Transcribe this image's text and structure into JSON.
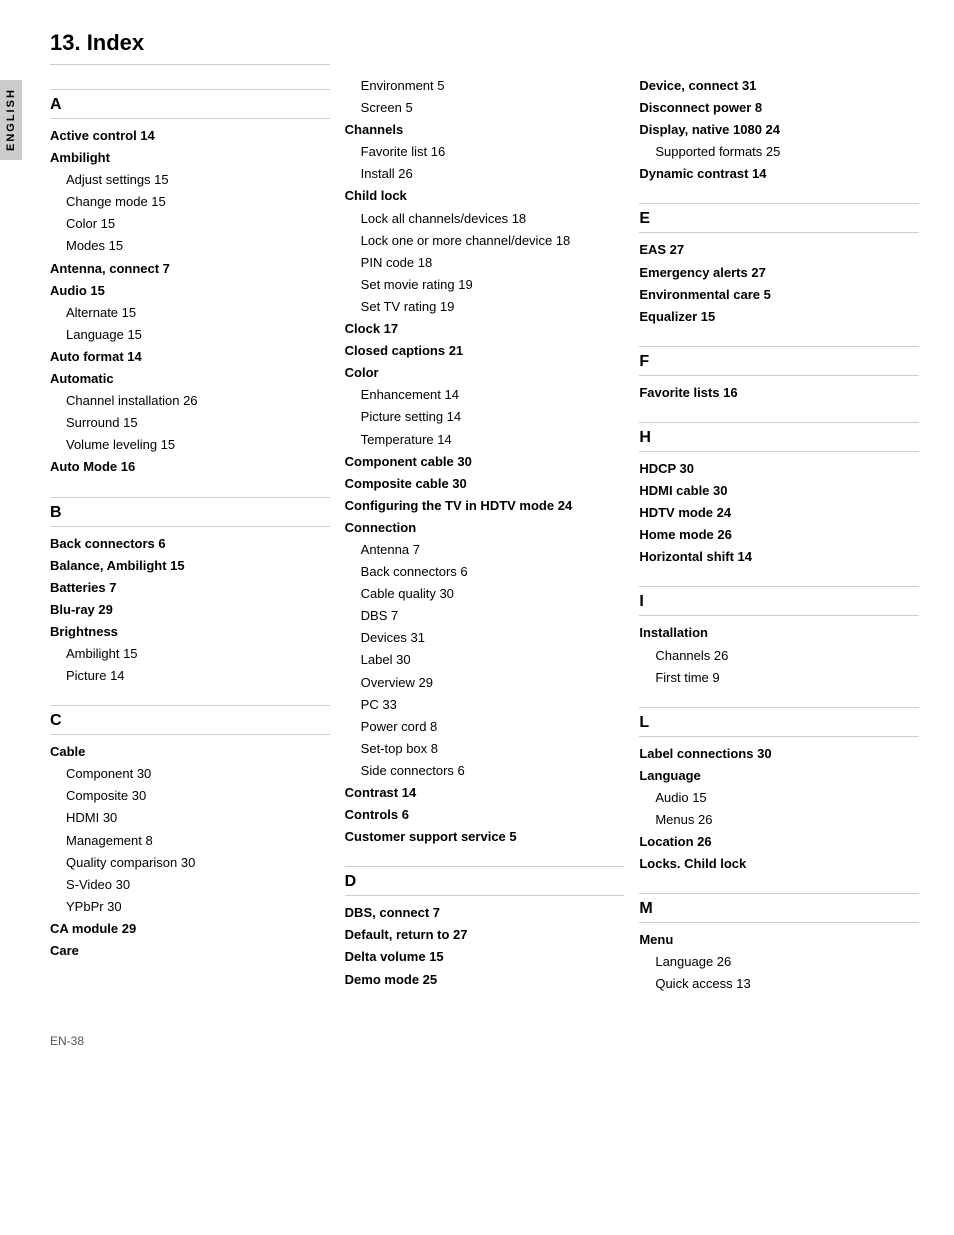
{
  "page": {
    "tab_label": "ENGLISH",
    "title": "13.  Index",
    "footer": "EN-38"
  },
  "col1": {
    "sections": [
      {
        "letter": "A",
        "entries": [
          {
            "text": "Active control  14",
            "bold": true,
            "indent": false
          },
          {
            "text": "Ambilight",
            "bold": true,
            "indent": false
          },
          {
            "text": "Adjust settings  15",
            "bold": false,
            "indent": true
          },
          {
            "text": "Change mode  15",
            "bold": false,
            "indent": true
          },
          {
            "text": "Color  15",
            "bold": false,
            "indent": true
          },
          {
            "text": "Modes  15",
            "bold": false,
            "indent": true
          },
          {
            "text": "Antenna, connect  7",
            "bold": true,
            "indent": false
          },
          {
            "text": "Audio  15",
            "bold": true,
            "indent": false
          },
          {
            "text": "Alternate  15",
            "bold": false,
            "indent": true
          },
          {
            "text": "Language  15",
            "bold": false,
            "indent": true
          },
          {
            "text": "Auto format  14",
            "bold": true,
            "indent": false
          },
          {
            "text": "Automatic",
            "bold": true,
            "indent": false
          },
          {
            "text": "Channel installation  26",
            "bold": false,
            "indent": true
          },
          {
            "text": "Surround  15",
            "bold": false,
            "indent": true
          },
          {
            "text": "Volume leveling  15",
            "bold": false,
            "indent": true
          },
          {
            "text": "Auto Mode  16",
            "bold": true,
            "indent": false
          }
        ]
      },
      {
        "letter": "B",
        "entries": [
          {
            "text": "Back connectors  6",
            "bold": true,
            "indent": false
          },
          {
            "text": "Balance, Ambilight  15",
            "bold": true,
            "indent": false
          },
          {
            "text": "Batteries  7",
            "bold": true,
            "indent": false
          },
          {
            "text": "Blu-ray  29",
            "bold": true,
            "indent": false
          },
          {
            "text": "Brightness",
            "bold": true,
            "indent": false
          },
          {
            "text": "Ambilight  15",
            "bold": false,
            "indent": true
          },
          {
            "text": "Picture  14",
            "bold": false,
            "indent": true
          }
        ]
      },
      {
        "letter": "C",
        "entries": [
          {
            "text": "Cable",
            "bold": true,
            "indent": false
          },
          {
            "text": "Component  30",
            "bold": false,
            "indent": true
          },
          {
            "text": "Composite  30",
            "bold": false,
            "indent": true
          },
          {
            "text": "HDMI  30",
            "bold": false,
            "indent": true
          },
          {
            "text": "Management  8",
            "bold": false,
            "indent": true
          },
          {
            "text": "Quality comparison  30",
            "bold": false,
            "indent": true
          },
          {
            "text": "S-Video  30",
            "bold": false,
            "indent": true
          },
          {
            "text": "YPbPr  30",
            "bold": false,
            "indent": true
          },
          {
            "text": "CA module  29",
            "bold": true,
            "indent": false
          },
          {
            "text": "Care",
            "bold": true,
            "indent": false
          }
        ]
      }
    ]
  },
  "col2": {
    "sections": [
      {
        "letter": "",
        "entries": [
          {
            "text": "Environment  5",
            "bold": false,
            "indent": true
          },
          {
            "text": "Screen  5",
            "bold": false,
            "indent": true
          },
          {
            "text": "Channels",
            "bold": true,
            "indent": false
          },
          {
            "text": "Favorite list  16",
            "bold": false,
            "indent": true
          },
          {
            "text": "Install  26",
            "bold": false,
            "indent": true
          },
          {
            "text": "Child lock",
            "bold": true,
            "indent": false
          },
          {
            "text": "Lock all channels/devices  18",
            "bold": false,
            "indent": true
          },
          {
            "text": "Lock one or more channel/device  18",
            "bold": false,
            "indent": true
          },
          {
            "text": "PIN code  18",
            "bold": false,
            "indent": true
          },
          {
            "text": "Set movie rating  19",
            "bold": false,
            "indent": true
          },
          {
            "text": "Set TV rating  19",
            "bold": false,
            "indent": true
          },
          {
            "text": "Clock  17",
            "bold": true,
            "indent": false
          },
          {
            "text": "Closed captions  21",
            "bold": true,
            "indent": false
          },
          {
            "text": "Color",
            "bold": true,
            "indent": false
          },
          {
            "text": "Enhancement  14",
            "bold": false,
            "indent": true
          },
          {
            "text": "Picture setting  14",
            "bold": false,
            "indent": true
          },
          {
            "text": "Temperature  14",
            "bold": false,
            "indent": true
          },
          {
            "text": "Component cable  30",
            "bold": true,
            "indent": false
          },
          {
            "text": "Composite cable  30",
            "bold": true,
            "indent": false
          },
          {
            "text": "Configuring the TV in HDTV mode  24",
            "bold": true,
            "indent": false
          },
          {
            "text": "Connection",
            "bold": true,
            "indent": false
          },
          {
            "text": "Antenna  7",
            "bold": false,
            "indent": true
          },
          {
            "text": "Back connectors  6",
            "bold": false,
            "indent": true
          },
          {
            "text": "Cable quality  30",
            "bold": false,
            "indent": true
          },
          {
            "text": "DBS  7",
            "bold": false,
            "indent": true
          },
          {
            "text": "Devices  31",
            "bold": false,
            "indent": true
          },
          {
            "text": "Label  30",
            "bold": false,
            "indent": true
          },
          {
            "text": "Overview  29",
            "bold": false,
            "indent": true
          },
          {
            "text": "PC  33",
            "bold": false,
            "indent": true
          },
          {
            "text": "Power cord  8",
            "bold": false,
            "indent": true
          },
          {
            "text": "Set-top box  8",
            "bold": false,
            "indent": true
          },
          {
            "text": "Side connectors  6",
            "bold": false,
            "indent": true
          },
          {
            "text": "Contrast  14",
            "bold": true,
            "indent": false
          },
          {
            "text": "Controls  6",
            "bold": true,
            "indent": false
          },
          {
            "text": "Customer support service  5",
            "bold": true,
            "indent": false
          }
        ]
      },
      {
        "letter": "D",
        "entries": [
          {
            "text": "DBS, connect  7",
            "bold": true,
            "indent": false
          },
          {
            "text": "Default, return to  27",
            "bold": true,
            "indent": false
          },
          {
            "text": "Delta volume  15",
            "bold": true,
            "indent": false
          },
          {
            "text": "Demo mode  25",
            "bold": true,
            "indent": false
          }
        ]
      }
    ]
  },
  "col3": {
    "sections": [
      {
        "letter": "",
        "entries": [
          {
            "text": "Device, connect  31",
            "bold": true,
            "indent": false
          },
          {
            "text": "Disconnect power  8",
            "bold": true,
            "indent": false
          },
          {
            "text": "Display, native 1080  24",
            "bold": true,
            "indent": false
          },
          {
            "text": "Supported formats  25",
            "bold": false,
            "indent": true
          },
          {
            "text": "Dynamic contrast  14",
            "bold": true,
            "indent": false
          }
        ]
      },
      {
        "letter": "E",
        "entries": [
          {
            "text": "EAS  27",
            "bold": true,
            "indent": false
          },
          {
            "text": "Emergency alerts  27",
            "bold": true,
            "indent": false
          },
          {
            "text": "Environmental care  5",
            "bold": true,
            "indent": false
          },
          {
            "text": "Equalizer  15",
            "bold": true,
            "indent": false
          }
        ]
      },
      {
        "letter": "F",
        "entries": [
          {
            "text": "Favorite lists  16",
            "bold": true,
            "indent": false
          }
        ]
      },
      {
        "letter": "H",
        "entries": [
          {
            "text": "HDCP  30",
            "bold": true,
            "indent": false
          },
          {
            "text": "HDMI cable  30",
            "bold": true,
            "indent": false
          },
          {
            "text": "HDTV mode  24",
            "bold": true,
            "indent": false
          },
          {
            "text": "Home mode  26",
            "bold": true,
            "indent": false
          },
          {
            "text": "Horizontal shift  14",
            "bold": true,
            "indent": false
          }
        ]
      },
      {
        "letter": "I",
        "entries": [
          {
            "text": "Installation",
            "bold": true,
            "indent": false
          },
          {
            "text": "Channels  26",
            "bold": false,
            "indent": true
          },
          {
            "text": "First time  9",
            "bold": false,
            "indent": true
          }
        ]
      },
      {
        "letter": "L",
        "entries": [
          {
            "text": "Label connections  30",
            "bold": true,
            "indent": false
          },
          {
            "text": "Language",
            "bold": true,
            "indent": false
          },
          {
            "text": "Audio  15",
            "bold": false,
            "indent": true
          },
          {
            "text": "Menus  26",
            "bold": false,
            "indent": true
          },
          {
            "text": "Location  26",
            "bold": true,
            "indent": false
          },
          {
            "text": "Locks.      Child lock",
            "bold": true,
            "indent": false
          }
        ]
      },
      {
        "letter": "M",
        "entries": [
          {
            "text": "Menu",
            "bold": true,
            "indent": false
          },
          {
            "text": "Language  26",
            "bold": false,
            "indent": true
          },
          {
            "text": "Quick access  13",
            "bold": false,
            "indent": true
          }
        ]
      }
    ]
  }
}
